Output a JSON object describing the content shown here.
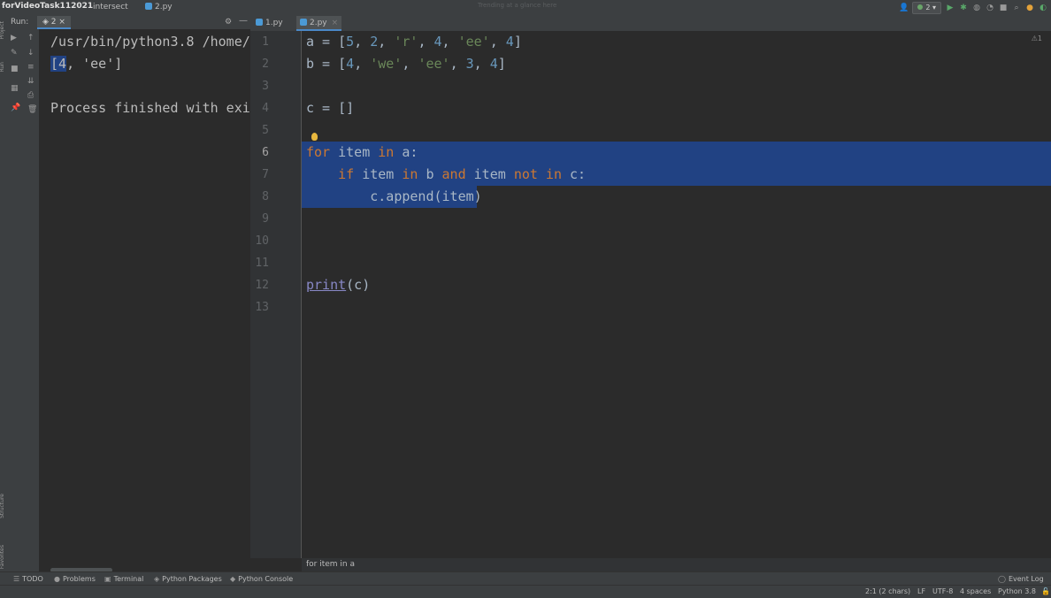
{
  "titlebar": {
    "project": "forVideoTask112021",
    "crumb1": "intersect",
    "crumb2": "2.py",
    "faint": "Trending at a glance here",
    "run_config": "2"
  },
  "run_panel": {
    "label": "Run:",
    "tab": "2",
    "output": {
      "line1": "/usr/bin/python3.8 /home/p",
      "line2_sel": "[4",
      "line2_rest": ", 'ee']",
      "line3": "Process finished with exit"
    }
  },
  "editor": {
    "tabs": [
      "1.py",
      "2.py"
    ],
    "active_tab": "2.py",
    "line_numbers": [
      "1",
      "2",
      "3",
      "4",
      "5",
      "6",
      "7",
      "8",
      "9",
      "10",
      "11",
      "12",
      "13"
    ],
    "inspection_label": "⚠1",
    "breadcrumb": "for item in a"
  },
  "code": {
    "l1": {
      "lhs": "a = [",
      "v1": "5",
      "c1": ", ",
      "v2": "2",
      "c2": ", ",
      "v3": "'r'",
      "c3": ", ",
      "v4": "4",
      "c4": ", ",
      "v5": "'ee'",
      "c5": ", ",
      "v6": "4",
      "end": "]"
    },
    "l2": {
      "lhs": "b = [",
      "v1": "4",
      "c1": ", ",
      "v2": "'we'",
      "c2": ", ",
      "v3": "'ee'",
      "c3": ", ",
      "v4": "3",
      "c4": ", ",
      "v5": "4",
      "end": "]"
    },
    "l4": "c = []",
    "l6": {
      "kw1": "for",
      "t1": " item ",
      "kw2": "in",
      "t2": " a:"
    },
    "l7": {
      "indent": "    ",
      "kw1": "if",
      "t1": " item ",
      "kw2": "in",
      "t2": " b ",
      "kw3": "and",
      "t3": " item ",
      "kw4": "not in",
      "t4": " c:"
    },
    "l8": "        c.append(item)",
    "l12": {
      "fn": "print",
      "rest": "(c)"
    }
  },
  "toolwindows": {
    "todo": "TODO",
    "problems": "Problems",
    "terminal": "Terminal",
    "packages": "Python Packages",
    "console": "Python Console",
    "eventlog": "Event Log"
  },
  "status": {
    "position": "2:1 (2 chars)",
    "line_sep": "LF",
    "encoding": "UTF-8",
    "indent": "4 spaces",
    "interpreter": "Python 3.8"
  },
  "icons": [
    "run-icon",
    "debug-icon",
    "stop-icon",
    "gear-icon",
    "search-icon",
    "bulb-icon",
    "lock-icon"
  ],
  "colors": {
    "selection": "#214283",
    "keyword": "#cc7832",
    "string": "#6a8759",
    "number": "#6897bb",
    "builtin": "#8888c6"
  }
}
